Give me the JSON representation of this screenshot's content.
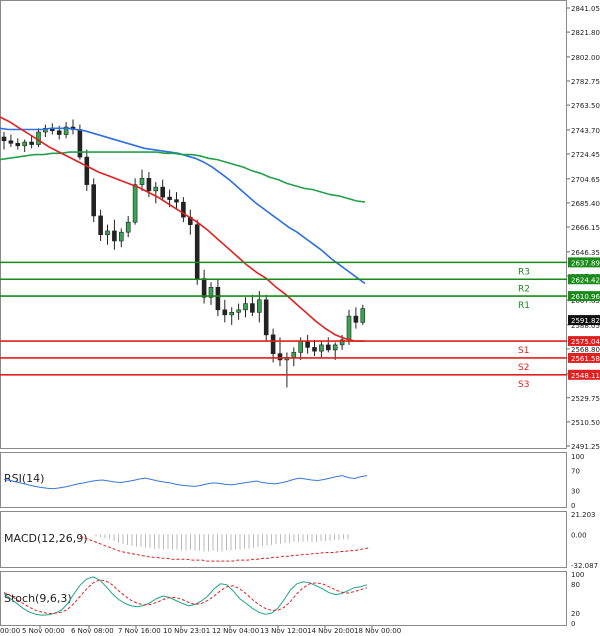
{
  "chart_data": {
    "type": "candlestick",
    "price_axis": {
      "ticks": [
        "2841.05",
        "2821.80",
        "2802.00",
        "2782.75",
        "2763.50",
        "2743.70",
        "2724.45",
        "2704.65",
        "2685.40",
        "2666.15",
        "2646.35",
        "2627.10",
        "2607.85",
        "2588.05",
        "2568.80",
        "2549.00",
        "2529.75",
        "2510.50",
        "2491.25"
      ],
      "range": [
        2491.25,
        2841.05
      ]
    },
    "time_axis": {
      "labels": [
        "5 Nov 00:00",
        "6 Nov 08:00",
        "7 Nov 16:00",
        "10 Nov 23:01",
        "12 Nov 04:00",
        "13 Nov 12:00",
        "14 Nov 20:00",
        "18 Nov 00:00"
      ],
      "edge_label": "00:00"
    },
    "candles": [
      [
        2738,
        2742,
        2728,
        2735
      ],
      [
        2735,
        2740,
        2730,
        2733
      ],
      [
        2733,
        2737,
        2728,
        2731
      ],
      [
        2731,
        2736,
        2726,
        2734
      ],
      [
        2734,
        2739,
        2729,
        2732
      ],
      [
        2732,
        2745,
        2730,
        2742
      ],
      [
        2742,
        2748,
        2738,
        2745
      ],
      [
        2745,
        2749,
        2740,
        2743
      ],
      [
        2743,
        2747,
        2736,
        2740
      ],
      [
        2740,
        2750,
        2737,
        2746
      ],
      [
        2746,
        2752,
        2740,
        2744
      ],
      [
        2744,
        2748,
        2720,
        2722
      ],
      [
        2722,
        2728,
        2695,
        2700
      ],
      [
        2700,
        2705,
        2670,
        2675
      ],
      [
        2675,
        2680,
        2655,
        2660
      ],
      [
        2660,
        2668,
        2652,
        2663
      ],
      [
        2663,
        2672,
        2648,
        2655
      ],
      [
        2655,
        2665,
        2650,
        2662
      ],
      [
        2662,
        2675,
        2658,
        2670
      ],
      [
        2670,
        2705,
        2668,
        2700
      ],
      [
        2700,
        2712,
        2695,
        2705
      ],
      [
        2705,
        2710,
        2690,
        2695
      ],
      [
        2695,
        2702,
        2685,
        2698
      ],
      [
        2698,
        2704,
        2688,
        2690
      ],
      [
        2690,
        2696,
        2682,
        2688
      ],
      [
        2688,
        2694,
        2680,
        2686
      ],
      [
        2686,
        2690,
        2670,
        2674
      ],
      [
        2674,
        2680,
        2660,
        2668
      ],
      [
        2668,
        2672,
        2620,
        2625
      ],
      [
        2625,
        2632,
        2605,
        2610
      ],
      [
        2610,
        2622,
        2604,
        2618
      ],
      [
        2618,
        2624,
        2595,
        2600
      ],
      [
        2600,
        2608,
        2590,
        2596
      ],
      [
        2596,
        2602,
        2588,
        2598
      ],
      [
        2598,
        2605,
        2592,
        2600
      ],
      [
        2600,
        2610,
        2594,
        2605
      ],
      [
        2605,
        2612,
        2595,
        2598
      ],
      [
        2598,
        2615,
        2590,
        2608
      ],
      [
        2608,
        2612,
        2575,
        2580
      ],
      [
        2580,
        2585,
        2558,
        2565
      ],
      [
        2565,
        2578,
        2555,
        2560
      ],
      [
        2560,
        2566,
        2538,
        2562
      ],
      [
        2562,
        2570,
        2555,
        2566
      ],
      [
        2566,
        2578,
        2560,
        2575
      ],
      [
        2575,
        2580,
        2565,
        2570
      ],
      [
        2570,
        2576,
        2563,
        2567
      ],
      [
        2567,
        2575,
        2562,
        2572
      ],
      [
        2572,
        2578,
        2566,
        2568
      ],
      [
        2568,
        2574,
        2560,
        2572
      ],
      [
        2572,
        2580,
        2568,
        2576
      ],
      [
        2576,
        2600,
        2572,
        2595
      ],
      [
        2595,
        2602,
        2585,
        2590
      ],
      [
        2590,
        2604,
        2588,
        2601
      ]
    ],
    "lines": [
      {
        "color": "#2f6fe0",
        "values": [
          2745,
          2744,
          2744,
          2744,
          2744,
          2744,
          2745,
          2745,
          2745,
          2744,
          2743,
          2741,
          2739,
          2737,
          2735,
          2733,
          2731,
          2729,
          2728,
          2727,
          2726,
          2725,
          2723,
          2721,
          2718,
          2714,
          2709,
          2704,
          2698,
          2692,
          2686,
          2681,
          2676,
          2671,
          2666,
          2662,
          2657,
          2652,
          2647,
          2641,
          2636,
          2631,
          2626,
          2621
        ]
      },
      {
        "color": "#22a04a",
        "values": [
          2720,
          2721,
          2722,
          2723,
          2724,
          2724,
          2725,
          2725,
          2726,
          2726,
          2726,
          2726,
          2726,
          2726,
          2726,
          2726,
          2726,
          2726,
          2726,
          2725,
          2725,
          2724,
          2724,
          2723,
          2721,
          2720,
          2718,
          2716,
          2714,
          2711,
          2709,
          2706,
          2704,
          2701,
          2699,
          2697,
          2696,
          2694,
          2692,
          2691,
          2689,
          2687,
          2686
        ]
      },
      {
        "color": "#e02020",
        "values": [
          2754,
          2750,
          2745,
          2740,
          2735,
          2730,
          2726,
          2722,
          2718,
          2714,
          2710,
          2707,
          2704,
          2701,
          2698,
          2694,
          2690,
          2685,
          2680,
          2675,
          2670,
          2664,
          2657,
          2650,
          2643,
          2636,
          2630,
          2625,
          2618,
          2612,
          2605,
          2598,
          2591,
          2585,
          2580,
          2577,
          2575,
          2575
        ]
      }
    ],
    "levels": [
      {
        "name": "R3",
        "value": 2637.89,
        "label": "2637.89",
        "color": "#1a8a1a"
      },
      {
        "name": "R2",
        "value": 2624.42,
        "label": "2624.42",
        "color": "#1a8a1a"
      },
      {
        "name": "R1",
        "value": 2610.96,
        "label": "2610.96",
        "color": "#1a8a1a"
      },
      {
        "name": "S1",
        "value": 2575.04,
        "label": "2575.04",
        "color": "#e02020"
      },
      {
        "name": "S2",
        "value": 2561.58,
        "label": "2561.58",
        "color": "#e02020"
      },
      {
        "name": "S3",
        "value": 2548.11,
        "label": "2548.11",
        "color": "#e02020"
      }
    ],
    "current_price": "2591.82",
    "indicators": [
      {
        "name": "RSI(14)",
        "ticks": [
          "100",
          "70",
          "30",
          "0"
        ],
        "range": [
          0,
          100
        ],
        "values": [
          52,
          50,
          47,
          44,
          41,
          38,
          36,
          34,
          33,
          35,
          37,
          40,
          43,
          45,
          48,
          50,
          51,
          49,
          47,
          46,
          48,
          50,
          53,
          55,
          52,
          49,
          47,
          45,
          42,
          40,
          39,
          38,
          40,
          43,
          45,
          44,
          42,
          41,
          43,
          45,
          47,
          49,
          46,
          44,
          43,
          45,
          48,
          52,
          55,
          53,
          51,
          50,
          52,
          55,
          58,
          60,
          56,
          54,
          58,
          60
        ]
      },
      {
        "name": "MACD(12,26,9)",
        "ticks": [
          "21.203",
          "0.00",
          "-32.087"
        ],
        "range": [
          -32.087,
          21.203
        ],
        "bars": [
          -2,
          -3,
          -4,
          -5,
          -7,
          -9,
          -10,
          -11,
          -12,
          -13,
          -13,
          -14,
          -14,
          -15,
          -15,
          -16,
          -15,
          -16,
          -16,
          -17,
          -17,
          -16,
          -17,
          -17,
          -18,
          -18,
          -17,
          -18,
          -18,
          -17,
          -17,
          -16,
          -16,
          -15,
          -15,
          -14,
          -13,
          -12,
          -12,
          -11,
          -10,
          -10,
          -9,
          -9,
          -8,
          -8,
          -8,
          -7,
          -8,
          -8,
          -7,
          -7,
          -7,
          -6,
          -6,
          -5,
          -5
        ],
        "signal": [
          -2,
          -4,
          -6,
          -8,
          -10,
          -12,
          -14,
          -16,
          -18,
          -19,
          -20,
          -21,
          -22,
          -23,
          -24,
          -24,
          -25,
          -25,
          -26,
          -26,
          -26,
          -26,
          -27,
          -27,
          -27,
          -28,
          -28,
          -28,
          -28,
          -28,
          -28,
          -27,
          -27,
          -27,
          -26,
          -26,
          -25,
          -25,
          -24,
          -24,
          -23,
          -23,
          -22,
          -22,
          -21,
          -21,
          -20,
          -20,
          -19,
          -19,
          -19,
          -18,
          -18,
          -17,
          -17,
          -16,
          -15,
          -14
        ]
      },
      {
        "name": "Stoch(9,6,3)",
        "ticks": [
          "100",
          "80",
          "20",
          "0"
        ],
        "range": [
          0,
          100
        ],
        "k": [
          60,
          50,
          40,
          30,
          22,
          18,
          16,
          17,
          20,
          26,
          40,
          60,
          78,
          90,
          94,
          88,
          75,
          60,
          48,
          40,
          35,
          33,
          36,
          42,
          50,
          55,
          52,
          46,
          40,
          35,
          38,
          45,
          55,
          70,
          80,
          78,
          65,
          50,
          40,
          30,
          22,
          18,
          20,
          30,
          48,
          68,
          80,
          84,
          82,
          76,
          70,
          62,
          58,
          60,
          66,
          72,
          74,
          78
        ],
        "d": [
          62,
          56,
          48,
          40,
          32,
          26,
          22,
          19,
          20,
          22,
          28,
          40,
          55,
          70,
          82,
          88,
          86,
          78,
          66,
          55,
          46,
          40,
          37,
          38,
          42,
          48,
          52,
          52,
          48,
          42,
          38,
          40,
          46,
          55,
          66,
          74,
          76,
          70,
          60,
          48,
          38,
          30,
          26,
          26,
          32,
          44,
          60,
          72,
          80,
          82,
          80,
          74,
          68,
          63,
          61,
          64,
          68,
          72
        ]
      }
    ]
  }
}
